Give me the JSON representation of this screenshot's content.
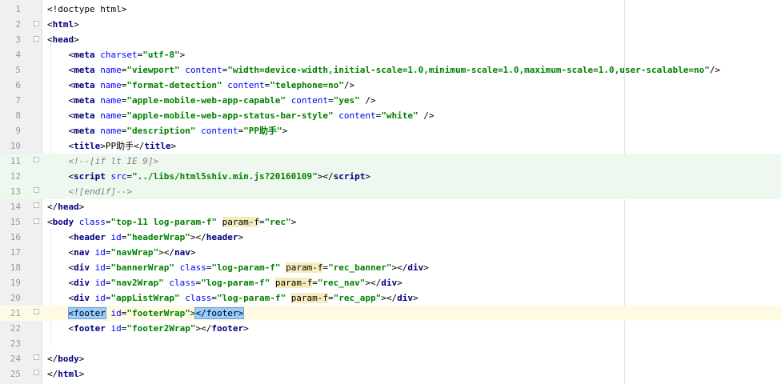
{
  "editor": {
    "line_numbers": [
      "1",
      "2",
      "3",
      "4",
      "5",
      "6",
      "7",
      "8",
      "9",
      "10",
      "11",
      "12",
      "13",
      "14",
      "15",
      "16",
      "17",
      "18",
      "19",
      "20",
      "21",
      "22",
      "23",
      "24",
      "25"
    ],
    "lines": [
      [
        {
          "c": "p",
          "t": "<!doctype html>"
        }
      ],
      [
        {
          "c": "p",
          "t": "<"
        },
        {
          "c": "t",
          "t": "html"
        },
        {
          "c": "p",
          "t": ">"
        }
      ],
      [
        {
          "c": "p",
          "t": "<"
        },
        {
          "c": "t",
          "t": "head"
        },
        {
          "c": "p",
          "t": ">"
        }
      ],
      [
        {
          "c": "p",
          "t": "    <"
        },
        {
          "c": "t",
          "t": "meta"
        },
        {
          "c": "p",
          "t": " "
        },
        {
          "c": "a",
          "t": "charset"
        },
        {
          "c": "p",
          "t": "="
        },
        {
          "c": "s",
          "t": "\"utf-8\""
        },
        {
          "c": "p",
          "t": ">"
        }
      ],
      [
        {
          "c": "p",
          "t": "    <"
        },
        {
          "c": "t",
          "t": "meta"
        },
        {
          "c": "p",
          "t": " "
        },
        {
          "c": "a",
          "t": "name"
        },
        {
          "c": "p",
          "t": "="
        },
        {
          "c": "s",
          "t": "\"viewport\""
        },
        {
          "c": "p",
          "t": " "
        },
        {
          "c": "a",
          "t": "content"
        },
        {
          "c": "p",
          "t": "="
        },
        {
          "c": "s",
          "t": "\"width=device-width,initial-scale=1.0,minimum-scale=1.0,maximum-scale=1.0,user-scalable=no\""
        },
        {
          "c": "p",
          "t": "/>"
        }
      ],
      [
        {
          "c": "p",
          "t": "    <"
        },
        {
          "c": "t",
          "t": "meta"
        },
        {
          "c": "p",
          "t": " "
        },
        {
          "c": "a",
          "t": "name"
        },
        {
          "c": "p",
          "t": "="
        },
        {
          "c": "s",
          "t": "\"format-detection\""
        },
        {
          "c": "p",
          "t": " "
        },
        {
          "c": "a",
          "t": "content"
        },
        {
          "c": "p",
          "t": "="
        },
        {
          "c": "s",
          "t": "\"telephone=no\""
        },
        {
          "c": "p",
          "t": "/>"
        }
      ],
      [
        {
          "c": "p",
          "t": "    <"
        },
        {
          "c": "t",
          "t": "meta"
        },
        {
          "c": "p",
          "t": " "
        },
        {
          "c": "a",
          "t": "name"
        },
        {
          "c": "p",
          "t": "="
        },
        {
          "c": "s",
          "t": "\"apple-mobile-web-app-capable\""
        },
        {
          "c": "p",
          "t": " "
        },
        {
          "c": "a",
          "t": "content"
        },
        {
          "c": "p",
          "t": "="
        },
        {
          "c": "s",
          "t": "\"yes\""
        },
        {
          "c": "p",
          "t": " />"
        }
      ],
      [
        {
          "c": "p",
          "t": "    <"
        },
        {
          "c": "t",
          "t": "meta"
        },
        {
          "c": "p",
          "t": " "
        },
        {
          "c": "a",
          "t": "name"
        },
        {
          "c": "p",
          "t": "="
        },
        {
          "c": "s",
          "t": "\"apple-mobile-web-app-status-bar-style\""
        },
        {
          "c": "p",
          "t": " "
        },
        {
          "c": "a",
          "t": "content"
        },
        {
          "c": "p",
          "t": "="
        },
        {
          "c": "s",
          "t": "\"white\""
        },
        {
          "c": "p",
          "t": " />"
        }
      ],
      [
        {
          "c": "p",
          "t": "    <"
        },
        {
          "c": "t",
          "t": "meta"
        },
        {
          "c": "p",
          "t": " "
        },
        {
          "c": "a",
          "t": "name"
        },
        {
          "c": "p",
          "t": "="
        },
        {
          "c": "s",
          "t": "\"description\""
        },
        {
          "c": "p",
          "t": " "
        },
        {
          "c": "a",
          "t": "content"
        },
        {
          "c": "p",
          "t": "="
        },
        {
          "c": "s",
          "t": "\"PP助手\""
        },
        {
          "c": "p",
          "t": ">"
        }
      ],
      [
        {
          "c": "p",
          "t": "    <"
        },
        {
          "c": "t",
          "t": "title"
        },
        {
          "c": "p",
          "t": ">PP助手</"
        },
        {
          "c": "t",
          "t": "title"
        },
        {
          "c": "p",
          "t": ">"
        }
      ],
      [
        {
          "c": "p",
          "t": "    "
        },
        {
          "c": "c",
          "t": "<!--[if lt IE 9]>"
        }
      ],
      [
        {
          "c": "p",
          "t": "    <"
        },
        {
          "c": "t",
          "t": "script"
        },
        {
          "c": "p",
          "t": " "
        },
        {
          "c": "a",
          "t": "src"
        },
        {
          "c": "p",
          "t": "="
        },
        {
          "c": "s",
          "t": "\"../libs/html5shiv.min.js?20160109\""
        },
        {
          "c": "p",
          "t": "></"
        },
        {
          "c": "t",
          "t": "script"
        },
        {
          "c": "p",
          "t": ">"
        }
      ],
      [
        {
          "c": "p",
          "t": "    "
        },
        {
          "c": "c",
          "t": "<![endif]-->"
        }
      ],
      [
        {
          "c": "p",
          "t": "</"
        },
        {
          "c": "t",
          "t": "head"
        },
        {
          "c": "p",
          "t": ">"
        }
      ],
      [
        {
          "c": "p",
          "t": "<"
        },
        {
          "c": "t",
          "t": "body"
        },
        {
          "c": "p",
          "t": " "
        },
        {
          "c": "a",
          "t": "class"
        },
        {
          "c": "p",
          "t": "="
        },
        {
          "c": "s",
          "t": "\"top-11 log-param-f\""
        },
        {
          "c": "p",
          "t": " "
        },
        {
          "c": "hl",
          "t": "param-f"
        },
        {
          "c": "p",
          "t": "="
        },
        {
          "c": "s",
          "t": "\"rec\""
        },
        {
          "c": "p",
          "t": ">"
        }
      ],
      [
        {
          "c": "p",
          "t": "    <"
        },
        {
          "c": "t",
          "t": "header"
        },
        {
          "c": "p",
          "t": " "
        },
        {
          "c": "a",
          "t": "id"
        },
        {
          "c": "p",
          "t": "="
        },
        {
          "c": "s",
          "t": "\"headerWrap\""
        },
        {
          "c": "p",
          "t": "></"
        },
        {
          "c": "t",
          "t": "header"
        },
        {
          "c": "p",
          "t": ">"
        }
      ],
      [
        {
          "c": "p",
          "t": "    <"
        },
        {
          "c": "t",
          "t": "nav"
        },
        {
          "c": "p",
          "t": " "
        },
        {
          "c": "a",
          "t": "id"
        },
        {
          "c": "p",
          "t": "="
        },
        {
          "c": "s",
          "t": "\"navWrap\""
        },
        {
          "c": "p",
          "t": "></"
        },
        {
          "c": "t",
          "t": "nav"
        },
        {
          "c": "p",
          "t": ">"
        }
      ],
      [
        {
          "c": "p",
          "t": "    <"
        },
        {
          "c": "t",
          "t": "div"
        },
        {
          "c": "p",
          "t": " "
        },
        {
          "c": "a",
          "t": "id"
        },
        {
          "c": "p",
          "t": "="
        },
        {
          "c": "s",
          "t": "\"bannerWrap\""
        },
        {
          "c": "p",
          "t": " "
        },
        {
          "c": "a",
          "t": "class"
        },
        {
          "c": "p",
          "t": "="
        },
        {
          "c": "s",
          "t": "\"log-param-f\""
        },
        {
          "c": "p",
          "t": " "
        },
        {
          "c": "hl",
          "t": "param-f"
        },
        {
          "c": "p",
          "t": "="
        },
        {
          "c": "s",
          "t": "\"rec_banner\""
        },
        {
          "c": "p",
          "t": "></"
        },
        {
          "c": "t",
          "t": "div"
        },
        {
          "c": "p",
          "t": ">"
        }
      ],
      [
        {
          "c": "p",
          "t": "    <"
        },
        {
          "c": "t",
          "t": "div"
        },
        {
          "c": "p",
          "t": " "
        },
        {
          "c": "a",
          "t": "id"
        },
        {
          "c": "p",
          "t": "="
        },
        {
          "c": "s",
          "t": "\"nav2Wrap\""
        },
        {
          "c": "p",
          "t": " "
        },
        {
          "c": "a",
          "t": "class"
        },
        {
          "c": "p",
          "t": "="
        },
        {
          "c": "s",
          "t": "\"log-param-f\""
        },
        {
          "c": "p",
          "t": " "
        },
        {
          "c": "hl",
          "t": "param-f"
        },
        {
          "c": "p",
          "t": "="
        },
        {
          "c": "s",
          "t": "\"rec_nav\""
        },
        {
          "c": "p",
          "t": "></"
        },
        {
          "c": "t",
          "t": "div"
        },
        {
          "c": "p",
          "t": ">"
        }
      ],
      [
        {
          "c": "p",
          "t": "    <"
        },
        {
          "c": "t",
          "t": "div"
        },
        {
          "c": "p",
          "t": " "
        },
        {
          "c": "a",
          "t": "id"
        },
        {
          "c": "p",
          "t": "="
        },
        {
          "c": "s",
          "t": "\"appListWrap\""
        },
        {
          "c": "p",
          "t": " "
        },
        {
          "c": "a",
          "t": "class"
        },
        {
          "c": "p",
          "t": "="
        },
        {
          "c": "s",
          "t": "\"log-param-f\""
        },
        {
          "c": "p",
          "t": " "
        },
        {
          "c": "hl",
          "t": "param-f"
        },
        {
          "c": "p",
          "t": "="
        },
        {
          "c": "s",
          "t": "\"rec_app\""
        },
        {
          "c": "p",
          "t": "></"
        },
        {
          "c": "t",
          "t": "div"
        },
        {
          "c": "p",
          "t": ">"
        }
      ],
      [
        {
          "c": "p",
          "t": "    "
        },
        {
          "c": "sel",
          "t": "<footer"
        },
        {
          "c": "p",
          "t": " "
        },
        {
          "c": "a",
          "t": "id"
        },
        {
          "c": "p",
          "t": "="
        },
        {
          "c": "s",
          "t": "\"footerWrap\""
        },
        {
          "c": "p",
          "t": ">"
        },
        {
          "c": "sel",
          "t": "</footer>"
        },
        {
          "c": "caret",
          "t": ""
        }
      ],
      [
        {
          "c": "p",
          "t": "    <"
        },
        {
          "c": "t",
          "t": "footer"
        },
        {
          "c": "p",
          "t": " "
        },
        {
          "c": "a",
          "t": "id"
        },
        {
          "c": "p",
          "t": "="
        },
        {
          "c": "s",
          "t": "\"footer2Wrap\""
        },
        {
          "c": "p",
          "t": "></"
        },
        {
          "c": "t",
          "t": "footer"
        },
        {
          "c": "p",
          "t": ">"
        }
      ],
      [],
      [
        {
          "c": "p",
          "t": "</"
        },
        {
          "c": "t",
          "t": "body"
        },
        {
          "c": "p",
          "t": ">"
        }
      ],
      [
        {
          "c": "p",
          "t": "</"
        },
        {
          "c": "t",
          "t": "html"
        },
        {
          "c": "p",
          "t": ">"
        }
      ]
    ]
  }
}
